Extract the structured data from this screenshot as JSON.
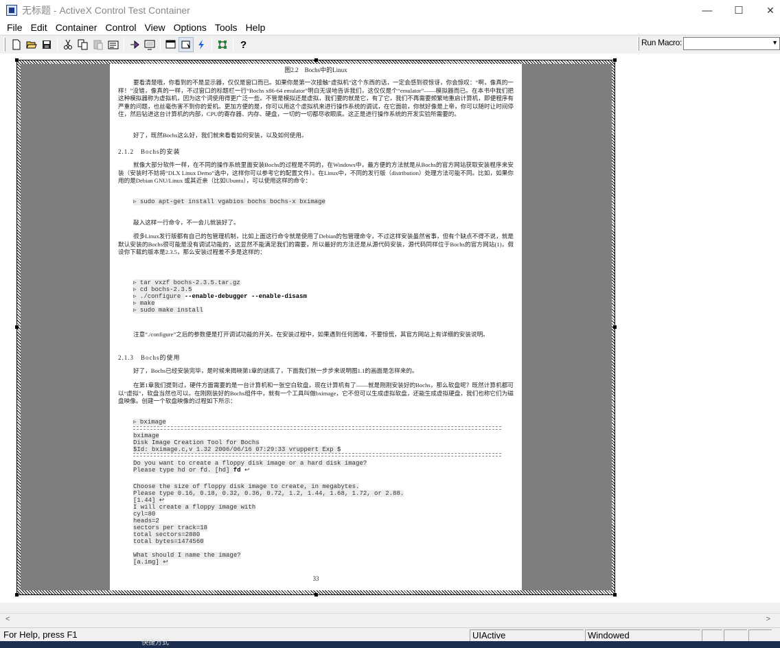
{
  "window": {
    "title": "无标题 - ActiveX Control Test Container",
    "minimize_glyph": "—",
    "maximize_glyph": "☐",
    "close_glyph": "✕"
  },
  "menu": [
    "File",
    "Edit",
    "Container",
    "Control",
    "View",
    "Options",
    "Tools",
    "Help"
  ],
  "toolbar": {
    "icons": [
      "new-icon",
      "open-icon",
      "save-icon",
      "cut-icon",
      "copy-icon",
      "paste-icon",
      "properties-icon",
      "invoke-methods-icon",
      "insert-control-icon",
      "activate-icon",
      "design-mode-icon",
      "events-icon",
      "settings-icon",
      "help-icon"
    ],
    "run_macro_label": "Run Macro:",
    "run_macro_value": ""
  },
  "document": {
    "figure_caption": "图2.2　Bochs中的Linux",
    "p1": "要看清楚哦，你看到的不是显示器，仅仅是窗口而已。如果你是第一次接触“虚拟机”这个东西的话，一定会感到很惊讶，你会惊叹：“啊，像真的一样！”没错，像真的一样，不过窗口的标题栏一行“Bochs x86-64 emulator”明白无误地告诉我们，这仅仅是个“emulator”——模拟器而已。在本书中我们把这种模拟器称为虚拟机，因为这个词使用得更广泛一些。不管是模拟还是虚拟，我们要的就是它，有了它，我们不再需要频繁地重启计算机，即便程序有严重的问题，也丝毫伤害不到你的爱机。更加方便的是，你可以用这个虚拟机来进行操作系统的调试，在它面前，你就好像是上帝，你可以随时让时间停住，然后钻进这台计算机的内部，CPU的寄存器、内存、硬盘，一切的一切都尽收眼底。这正是进行操作系统的开发实验所需要的。",
    "p2": "好了，既然Bochs这么好，我们就来看看如何安装，以及如何使用。",
    "h1": "2.1.2　Bochs的安装",
    "p3": "就像大部分软件一样，在不同的操作系统里面安装Bochs的过程是不同的，在Windows中，最方便的方法就是从Bochs的官方网站获取安装程序来安装（安装时不妨将“DLX Linux Demo”选中，这样你可以参考它的配置文件）。在Linux中，不同的发行版（distribution）处理方法可能不同。比如，如果你用的是Debian GNU/Linux 或其近亲（比如Ubuntu），可以使用这样的命令：",
    "code1": "▹ sudo apt-get install vgabios bochs bochs-x bximage",
    "p4": "敲入这样一行命令，不一会儿就装好了。",
    "p5": "很多Linux发行版都有自己的包管理机制，比如上面这行命令就是使用了Debian的包管理命令，不过这样安装虽然省事，但有个缺点不得不说，就是默认安装的Bochs很可能是没有调试功能的，这显然不能满足我们的需要，所以最好的方法还是从源代码安装，源代码同样位于Bochs的官方网站(1)，假设你下载的版本是2.3.5，那么安装过程差不多是这样的：",
    "code2": [
      "▹ tar vxzf bochs-2.3.5.tar.gz",
      "▹ cd bochs-2.3.5",
      "▹ ./configure ",
      "▹ make",
      "▹ sudo make install"
    ],
    "code2_bold": "--enable-debugger --enable-disasm",
    "p6": "注意“./configure”之后的参数便是打开调试功能的开关。在安装过程中，如果遇到任何困难，不要惊慌，其官方网站上有详细的安装说明。",
    "h2": "2.1.3　Bochs的使用",
    "p7": "好了，Bochs已经安装完毕，是时候来揭晓第1章的谜底了，下面我们就一步步来说明图1.1的画面是怎样来的。",
    "p8": "在第1章我们提到过，硬件方面需要的是一台计算机和一张空白软盘，现在计算机有了——就是刚刚安装好的Bochs，那么软盘呢？既然计算机都可以“虚拟”，软盘当然也可以。在刚刚装好的Bochs组件中，就有一个工具叫做bximage，它不但可以生成虚拟软盘，还能生成虚拟硬盘，我们也称它们为磁盘映像。创建一个软盘映像的过程如下所示：",
    "code3_a": "▹ bximage",
    "code3_b": [
      "bximage",
      "Disk Image Creation Tool for Bochs",
      "$Id: bximage.c,v 1.32 2006/06/16 07:29:33 vruppert Exp $"
    ],
    "code3_c1": "Do you want to create a floppy disk image or a hard disk image?",
    "code3_c2": "Please type hd or fd. [hd] ",
    "code3_c2_bold": "fd",
    "code3_d": [
      "Choose the size of floppy disk image to create, in megabytes.",
      "Please type 0.16, 0.18, 0.32, 0.36, 0.72, 1.2, 1.44, 1.68, 1.72, or 2.88.",
      "[1.44] ↩",
      "I will create a floppy image with",
      "cyl=80",
      "heads=2",
      "sectors per track=18",
      "total sectors=2880",
      "total bytes=1474560"
    ],
    "code3_e": [
      "What should I name the image?",
      "[a.img] ↩"
    ],
    "return_glyph": "↩",
    "page_number": "33"
  },
  "status": {
    "help": "For Help, press F1",
    "state": "UIActive",
    "mode": "Windowed"
  },
  "taskbar_text": "快捷方式"
}
